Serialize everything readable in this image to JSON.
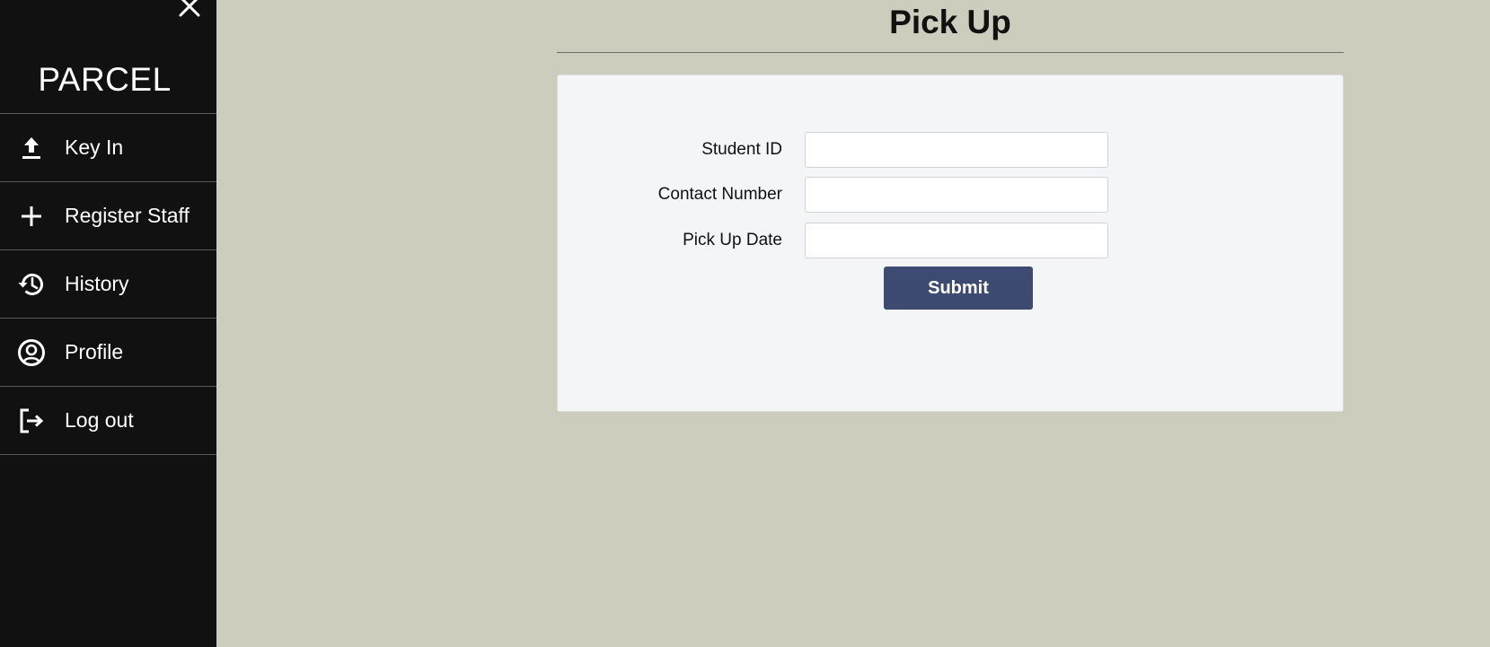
{
  "sidebar": {
    "brand": "PARCEL",
    "close_icon": "close-icon",
    "items": [
      {
        "label": "Key In",
        "icon": "upload-icon"
      },
      {
        "label": "Register Staff",
        "icon": "plus-icon"
      },
      {
        "label": "History",
        "icon": "history-icon"
      },
      {
        "label": "Profile",
        "icon": "account-circle-icon"
      },
      {
        "label": "Log out",
        "icon": "logout-icon"
      }
    ]
  },
  "main": {
    "title": "Pick Up",
    "form": {
      "fields": [
        {
          "label": "Student ID",
          "value": "",
          "placeholder": ""
        },
        {
          "label": "Contact Number",
          "value": "",
          "placeholder": ""
        },
        {
          "label": "Pick Up Date",
          "value": "",
          "placeholder": ""
        }
      ],
      "submit_label": "Submit"
    }
  },
  "colors": {
    "sidebar_bg": "#111111",
    "page_bg": "#cccdbd",
    "card_bg": "#f4f5f7",
    "button_bg": "#3d4b72"
  }
}
